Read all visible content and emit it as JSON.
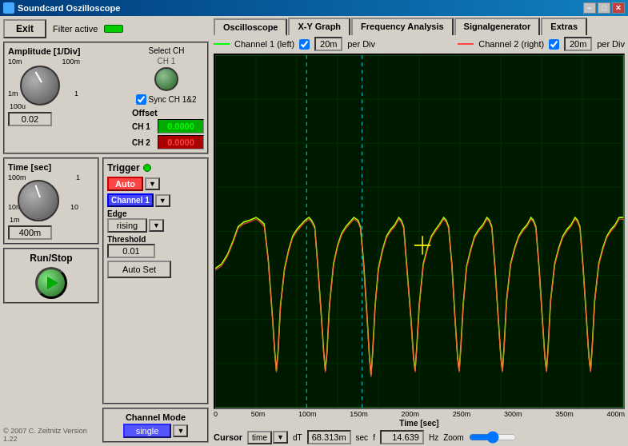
{
  "titlebar": {
    "title": "Soundcard Oszilloscope",
    "min": "−",
    "max": "□",
    "close": "✕"
  },
  "leftpanel": {
    "exit_label": "Exit",
    "filter_label": "Filter active",
    "amplitude_title": "Amplitude [1/Div]",
    "select_ch_label": "Select CH",
    "ch1_label": "CH 1",
    "sync_label": "Sync CH 1&2",
    "offset_title": "Offset",
    "ch1_offset": "0.0000",
    "ch2_offset": "0.0000",
    "ch1_offset_label": "CH 1",
    "ch2_offset_label": "CH 2",
    "amplitude_value": "0.02",
    "knob_labels": {
      "top_left": "10m",
      "top_right": "100m",
      "bottom_left": "1m",
      "bottom_right": "1",
      "bottom": "100u"
    },
    "time_title": "Time [sec]",
    "time_knob_labels": {
      "top_left": "100m",
      "top_right": "1",
      "bottom_left": "10m",
      "bottom_right": "10",
      "bottom": "1m"
    },
    "time_value": "400m",
    "run_stop_label": "Run/Stop",
    "trigger_title": "Trigger",
    "trigger_auto": "Auto",
    "trigger_channel": "Channel 1",
    "edge_label": "Edge",
    "edge_value": "rising",
    "threshold_label": "Threshold",
    "threshold_value": "0.01",
    "auto_set_label": "Auto Set",
    "channel_mode_label": "Channel Mode",
    "channel_mode_value": "single",
    "copyright": "© 2007  C. Zeitnitz Version 1.22"
  },
  "tabs": [
    {
      "label": "Oscilloscope",
      "active": true
    },
    {
      "label": "X-Y Graph",
      "active": false
    },
    {
      "label": "Frequency Analysis",
      "active": false
    },
    {
      "label": "Signalgenerator",
      "active": false
    },
    {
      "label": "Extras",
      "active": false
    }
  ],
  "channel_controls": {
    "ch1_label": "Channel 1 (left)",
    "ch1_per_div": "20m",
    "ch1_per_div_unit": "per Div",
    "ch2_label": "Channel 2 (right)",
    "ch2_per_div": "20m",
    "ch2_per_div_unit": "per Div"
  },
  "bottom_bar": {
    "cursor_label": "Cursor",
    "cursor_type": "time",
    "dt_label": "dT",
    "dt_value": "68.313m",
    "dt_unit": "sec",
    "f_label": "f",
    "f_value": "14.639",
    "f_unit": "Hz",
    "zoom_label": "Zoom"
  },
  "xaxis": {
    "labels": [
      "0",
      "50m",
      "100m",
      "150m",
      "200m",
      "250m",
      "300m",
      "350m",
      "400m"
    ],
    "title": "Time [sec]"
  },
  "colors": {
    "background": "#001400",
    "grid": "#005500",
    "ch1": "#aaff00",
    "ch2": "#ff4444",
    "cursor": "#00cccc",
    "accent": "#d4d0c8"
  }
}
